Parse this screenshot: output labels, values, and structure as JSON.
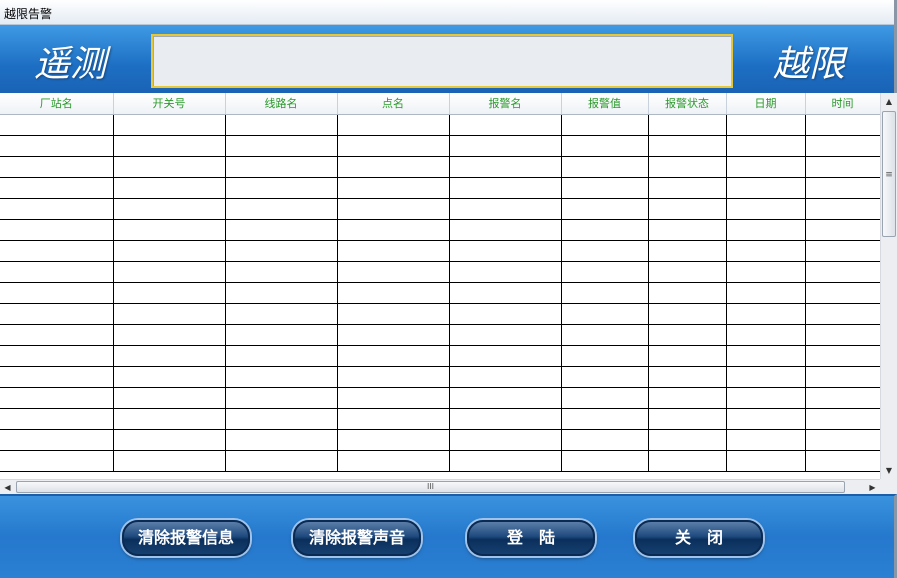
{
  "window": {
    "title": "越限告警"
  },
  "banner": {
    "left_label": "遥测",
    "right_label": "越限",
    "display_text": ""
  },
  "table": {
    "columns": [
      "厂站名",
      "开关号",
      "线路名",
      "点名",
      "报警名",
      "报警值",
      "报警状态",
      "日期",
      "时间"
    ],
    "rows": []
  },
  "scrollbar": {
    "h_thumb_glyph": "III",
    "v_thumb_glyph": "≡"
  },
  "buttons": {
    "clear_info": "清除报警信息",
    "clear_sound": "清除报警声音",
    "login": "登　陆",
    "close": "关　闭"
  },
  "colors": {
    "header_text": "#2a9a2a",
    "banner_blue": "#1d6fc4",
    "display_border": "#e4c83a"
  }
}
